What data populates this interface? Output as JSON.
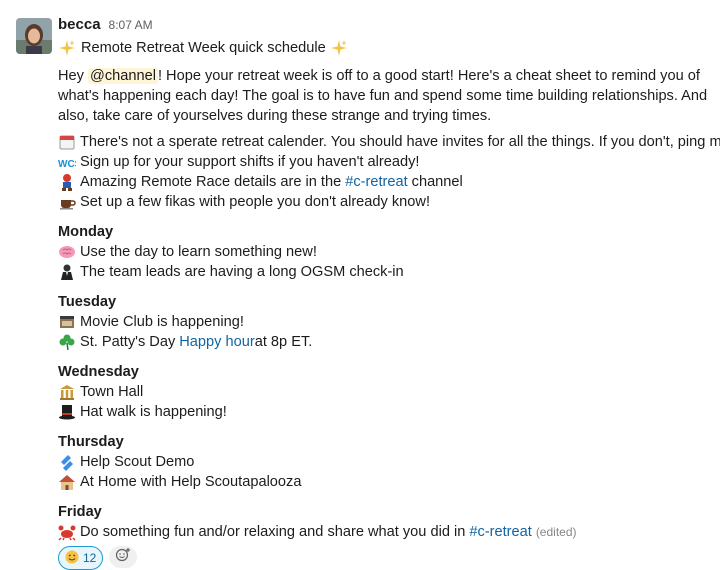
{
  "user": {
    "name": "becca",
    "time": "8:07 AM"
  },
  "title": "Remote Retreat Week quick schedule",
  "intro": {
    "before": "Hey ",
    "mention": "@channel",
    "after": "! Hope your retreat week is off to a good start! Here's a cheat sheet to remind you of what's happening each day! The goal is to have fun and spend some time building relationships. And also, take care of yourselves during these strange and trying times."
  },
  "bullets": [
    {
      "icon": "calendar-icon",
      "text": "There's not a sperate retreat calender. You should have invites for all the things. If you don't, ping me!"
    },
    {
      "icon": "wcs-icon",
      "text": "Sign up for your support shifts if you haven't already!"
    },
    {
      "icon": "racer-icon",
      "before": "Amazing Remote Race details are in the ",
      "link": "#c-retreat",
      "after": " channel"
    },
    {
      "icon": "coffee-icon",
      "text": "Set up a few fikas with people you don't already know!"
    }
  ],
  "days": [
    {
      "name": "Monday",
      "items": [
        {
          "icon": "brain-icon",
          "text": "Use the day to learn something new!"
        },
        {
          "icon": "business-icon",
          "text": "The team leads are having a long OGSM check-in"
        }
      ]
    },
    {
      "name": "Tuesday",
      "items": [
        {
          "icon": "movie-icon",
          "text": "Movie Club is happening!"
        },
        {
          "icon": "shamrock-icon",
          "before": "St. Patty's Day ",
          "link": "Happy hour",
          "after": " at 8p ET."
        }
      ]
    },
    {
      "name": "Wednesday",
      "items": [
        {
          "icon": "town-hall-icon",
          "text": "Town Hall"
        },
        {
          "icon": "top-hat-icon",
          "text": "Hat walk is happening!"
        }
      ]
    },
    {
      "name": "Thursday",
      "items": [
        {
          "icon": "help-scout-icon",
          "text": "Help Scout Demo"
        },
        {
          "icon": "house-icon",
          "text": "At Home with Help Scoutapalooza"
        }
      ]
    },
    {
      "name": "Friday",
      "items": [
        {
          "icon": "crab-icon",
          "before": "Do something fun and/or relaxing and share what you did in ",
          "link": "#c-retreat",
          "after": "",
          "edited": "(edited)"
        }
      ]
    }
  ],
  "reactions": [
    {
      "icon": "smile-icon",
      "count": "12"
    }
  ],
  "colors": {
    "link": "#1264a3",
    "mention_bg": "#fef5d7",
    "reaction_border": "#1d9bd1"
  }
}
